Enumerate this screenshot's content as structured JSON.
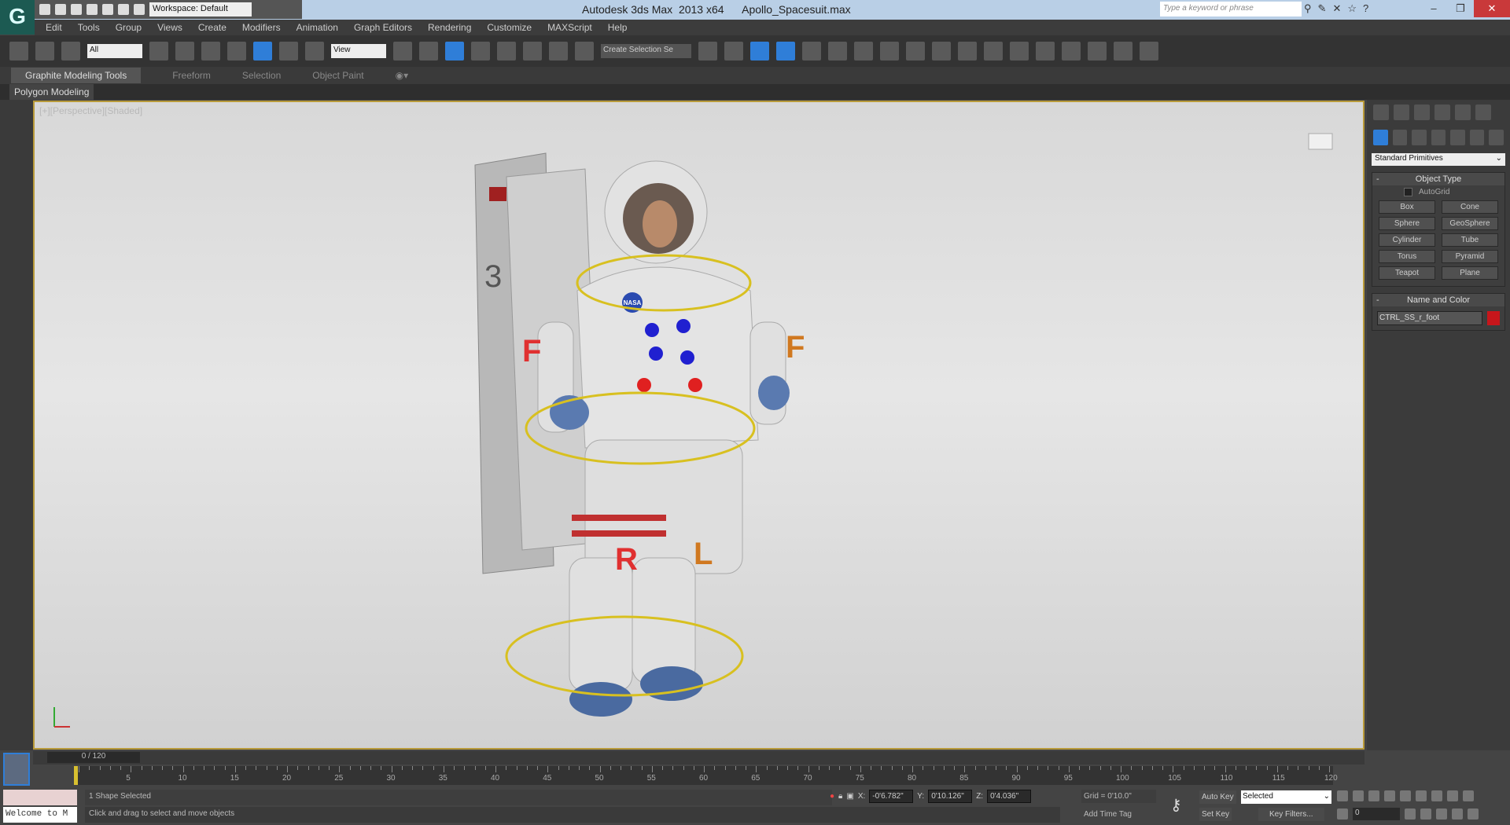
{
  "app": {
    "title": "Autodesk 3ds Max  2013 x64      Apollo_Spacesuit.max",
    "logo": "3ds Max logo",
    "workspace": "Workspace: Default",
    "search_placeholder": "Type a keyword or phrase"
  },
  "menu": [
    "Edit",
    "Tools",
    "Group",
    "Views",
    "Create",
    "Modifiers",
    "Animation",
    "Graph Editors",
    "Rendering",
    "Customize",
    "MAXScript",
    "Help"
  ],
  "toolbar": {
    "filter": "All",
    "refcoord": "View",
    "selection_set": "Create Selection Se"
  },
  "ribbon": {
    "tabs": [
      "Graphite Modeling Tools",
      "Freeform",
      "Selection",
      "Object Paint"
    ],
    "panel": "Polygon Modeling"
  },
  "viewport": {
    "label": "[+][Perspective][Shaded]",
    "markers": [
      "F",
      "F",
      "R",
      "L"
    ],
    "nasa": "NASA",
    "backpack_number": "3"
  },
  "command_panel": {
    "category": "Standard Primitives",
    "object_type": {
      "title": "Object Type",
      "autogrid": "AutoGrid",
      "buttons": [
        "Box",
        "Cone",
        "Sphere",
        "GeoSphere",
        "Cylinder",
        "Tube",
        "Torus",
        "Pyramid",
        "Teapot",
        "Plane"
      ]
    },
    "name_color": {
      "title": "Name and Color",
      "name": "CTRL_SS_r_foot",
      "color": "#c8161b"
    }
  },
  "timeline": {
    "slider": "0 / 120",
    "current": 0,
    "max": 120,
    "labels": [
      "5",
      "10",
      "15",
      "20",
      "25",
      "30",
      "35",
      "40",
      "45",
      "50",
      "55",
      "60",
      "65",
      "70",
      "75",
      "80",
      "85",
      "90",
      "95",
      "100",
      "105",
      "110",
      "115",
      "120"
    ]
  },
  "status": {
    "selection": "1 Shape Selected",
    "prompt": "Click and drag to select and move objects",
    "maxscript": "Welcome to M",
    "x": "-0'6.782\"",
    "y": "0'10.126\"",
    "z": "0'4.036\"",
    "grid": "Grid = 0'10.0\"",
    "add_time_tag": "Add Time Tag",
    "auto_key": "Auto Key",
    "set_key": "Set Key",
    "key_mode": "Selected",
    "key_filters": "Key Filters...",
    "frame": "0"
  }
}
